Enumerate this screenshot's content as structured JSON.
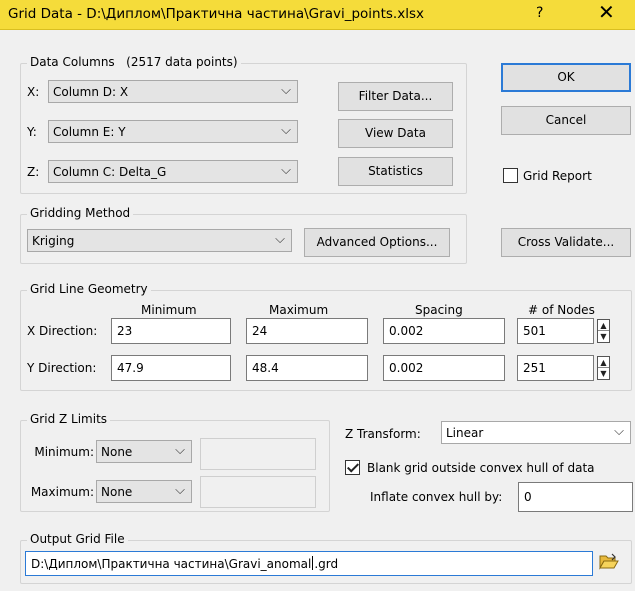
{
  "window": {
    "title": "Grid Data - D:\\Диплом\\Практична частина\\Gravi_points.xlsx",
    "help_glyph": "?",
    "close_glyph": "✕"
  },
  "data_columns": {
    "label": "Data Columns",
    "count_label": "(2517 data points)",
    "x": {
      "prefix": "X:",
      "value": "Column D:  X"
    },
    "y": {
      "prefix": "Y:",
      "value": "Column E:  Y"
    },
    "z": {
      "prefix": "Z:",
      "value": "Column C:  Delta_G"
    },
    "filter_button": "Filter Data...",
    "view_button": "View Data",
    "statistics_button": "Statistics"
  },
  "buttons": {
    "ok": "OK",
    "cancel": "Cancel",
    "cross_validate": "Cross Validate..."
  },
  "grid_report": {
    "label": "Grid Report",
    "checked": false
  },
  "gridding_method": {
    "label": "Gridding Method",
    "value": "Kriging",
    "advanced_button": "Advanced Options..."
  },
  "geometry": {
    "label": "Grid Line Geometry",
    "headers": {
      "minimum": "Minimum",
      "maximum": "Maximum",
      "spacing": "Spacing",
      "nodes": "# of Nodes"
    },
    "x": {
      "label": "X Direction:",
      "min": "23",
      "max": "24",
      "spacing": "0.002",
      "nodes": "501"
    },
    "y": {
      "label": "Y Direction:",
      "min": "47.9",
      "max": "48.4",
      "spacing": "0.002",
      "nodes": "251"
    }
  },
  "z_limits": {
    "label": "Grid Z Limits",
    "minimum_label": "Minimum:",
    "minimum_value": "None",
    "maximum_label": "Maximum:",
    "maximum_value": "None"
  },
  "z_transform": {
    "label": "Z Transform:",
    "value": "Linear"
  },
  "blank_hull": {
    "label": "Blank grid outside convex hull of data",
    "checked": true
  },
  "inflate": {
    "label": "Inflate convex hull by:",
    "value": "0"
  },
  "output": {
    "label": "Output Grid File",
    "path_before_cursor": "D:\\Диплом\\Практична частина\\Gravi_anomal",
    "path_after_cursor": ".grd"
  },
  "icons": {
    "arrow": "chevron-down-icon",
    "folder": "folder-open-icon"
  }
}
